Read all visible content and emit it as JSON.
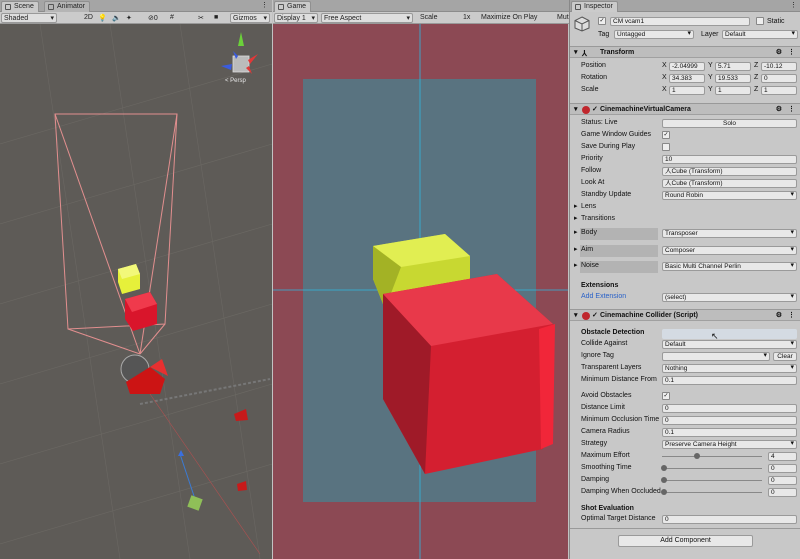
{
  "scene_tabs": {
    "scene": "Scene",
    "animator": "Animator"
  },
  "scene_toolbar": {
    "shading": "Shaded",
    "toggle_2d": "2D",
    "counter": "0",
    "gizmos": "Gizmos"
  },
  "scene_view": {
    "perspective_label": "< Persp"
  },
  "game_tab": "Game",
  "game_toolbar": {
    "display": "Display 1",
    "aspect": "Free Aspect",
    "scale_label": "Scale",
    "scale_value": "1x",
    "maximize": "Maximize On Play",
    "mute": "Mut"
  },
  "inspector": {
    "tab_title": "Inspector",
    "object_name": "CM vcam1",
    "static_label": "Static",
    "tag_label": "Tag",
    "tag_value": "Untagged",
    "layer_label": "Layer",
    "layer_value": "Default",
    "transform": {
      "title": "Transform",
      "rows": [
        {
          "label": "Position",
          "x": "-2.04999",
          "y": "5.71",
          "z": "-10.12"
        },
        {
          "label": "Rotation",
          "x": "34.383",
          "y": "19.533",
          "z": "0"
        },
        {
          "label": "Scale",
          "x": "1",
          "y": "1",
          "z": "1"
        }
      ]
    },
    "vcam": {
      "title": "CinemachineVirtualCamera",
      "status_label": "Status: Live",
      "solo_button": "Solo",
      "game_window_guides": "Game Window Guides",
      "guides_checked": "✓",
      "save_during_play": "Save During Play",
      "priority_label": "Priority",
      "priority_value": "10",
      "follow_label": "Follow",
      "follow_value": "人Cube (Transform)",
      "lookat_label": "Look At",
      "lookat_value": "人Cube (Transform)",
      "standby_label": "Standby Update",
      "standby_value": "Round Robin",
      "lens": "Lens",
      "transitions": "Transitions",
      "body_label": "Body",
      "body_value": "Transposer",
      "aim_label": "Aim",
      "aim_value": "Composer",
      "noise_label": "Noise",
      "noise_value": "Basic Multi Channel Perlin",
      "extensions_label": "Extensions",
      "add_extension_label": "Add Extension",
      "add_extension_value": "(select)"
    },
    "collider": {
      "title": "Cinemachine Collider (Script)",
      "obstacle_detection": "Obstacle Detection",
      "collide_against_label": "Collide Against",
      "collide_against_value": "Default",
      "ignore_tag_label": "Ignore Tag",
      "clear_button": "Clear",
      "transparent_layers_label": "Transparent Layers",
      "transparent_layers_value": "Nothing",
      "min_distance_label": "Minimum Distance From",
      "min_distance_value": "0.1",
      "avoid_obstacles_label": "Avoid Obstacles",
      "avoid_checked": "✓",
      "distance_limit_label": "Distance Limit",
      "distance_limit_value": "0",
      "min_occlusion_label": "Minimum Occlusion Time",
      "min_occlusion_value": "0",
      "camera_radius_label": "Camera Radius",
      "camera_radius_value": "0.1",
      "strategy_label": "Strategy",
      "strategy_value": "Preserve Camera Height",
      "max_effort_label": "Maximum Effort",
      "max_effort_value": "4",
      "max_effort_level": 0.35,
      "smoothing_label": "Smoothing Time",
      "smoothing_value": "0",
      "damping_label": "Damping",
      "damping_value": "0",
      "damping_occluded_label": "Damping When Occluded",
      "damping_occluded_value": "0",
      "shot_evaluation": "Shot Evaluation",
      "optimal_target_label": "Optimal Target Distance",
      "optimal_target_value": "0"
    },
    "add_component": "Add Component"
  },
  "colors": {
    "game_bg": "#8c4954",
    "game_safe": "#58707c",
    "scene_bg": "#5e5b57",
    "cube_red": "#e0283b",
    "cube_yellow": "#d4e33a"
  }
}
